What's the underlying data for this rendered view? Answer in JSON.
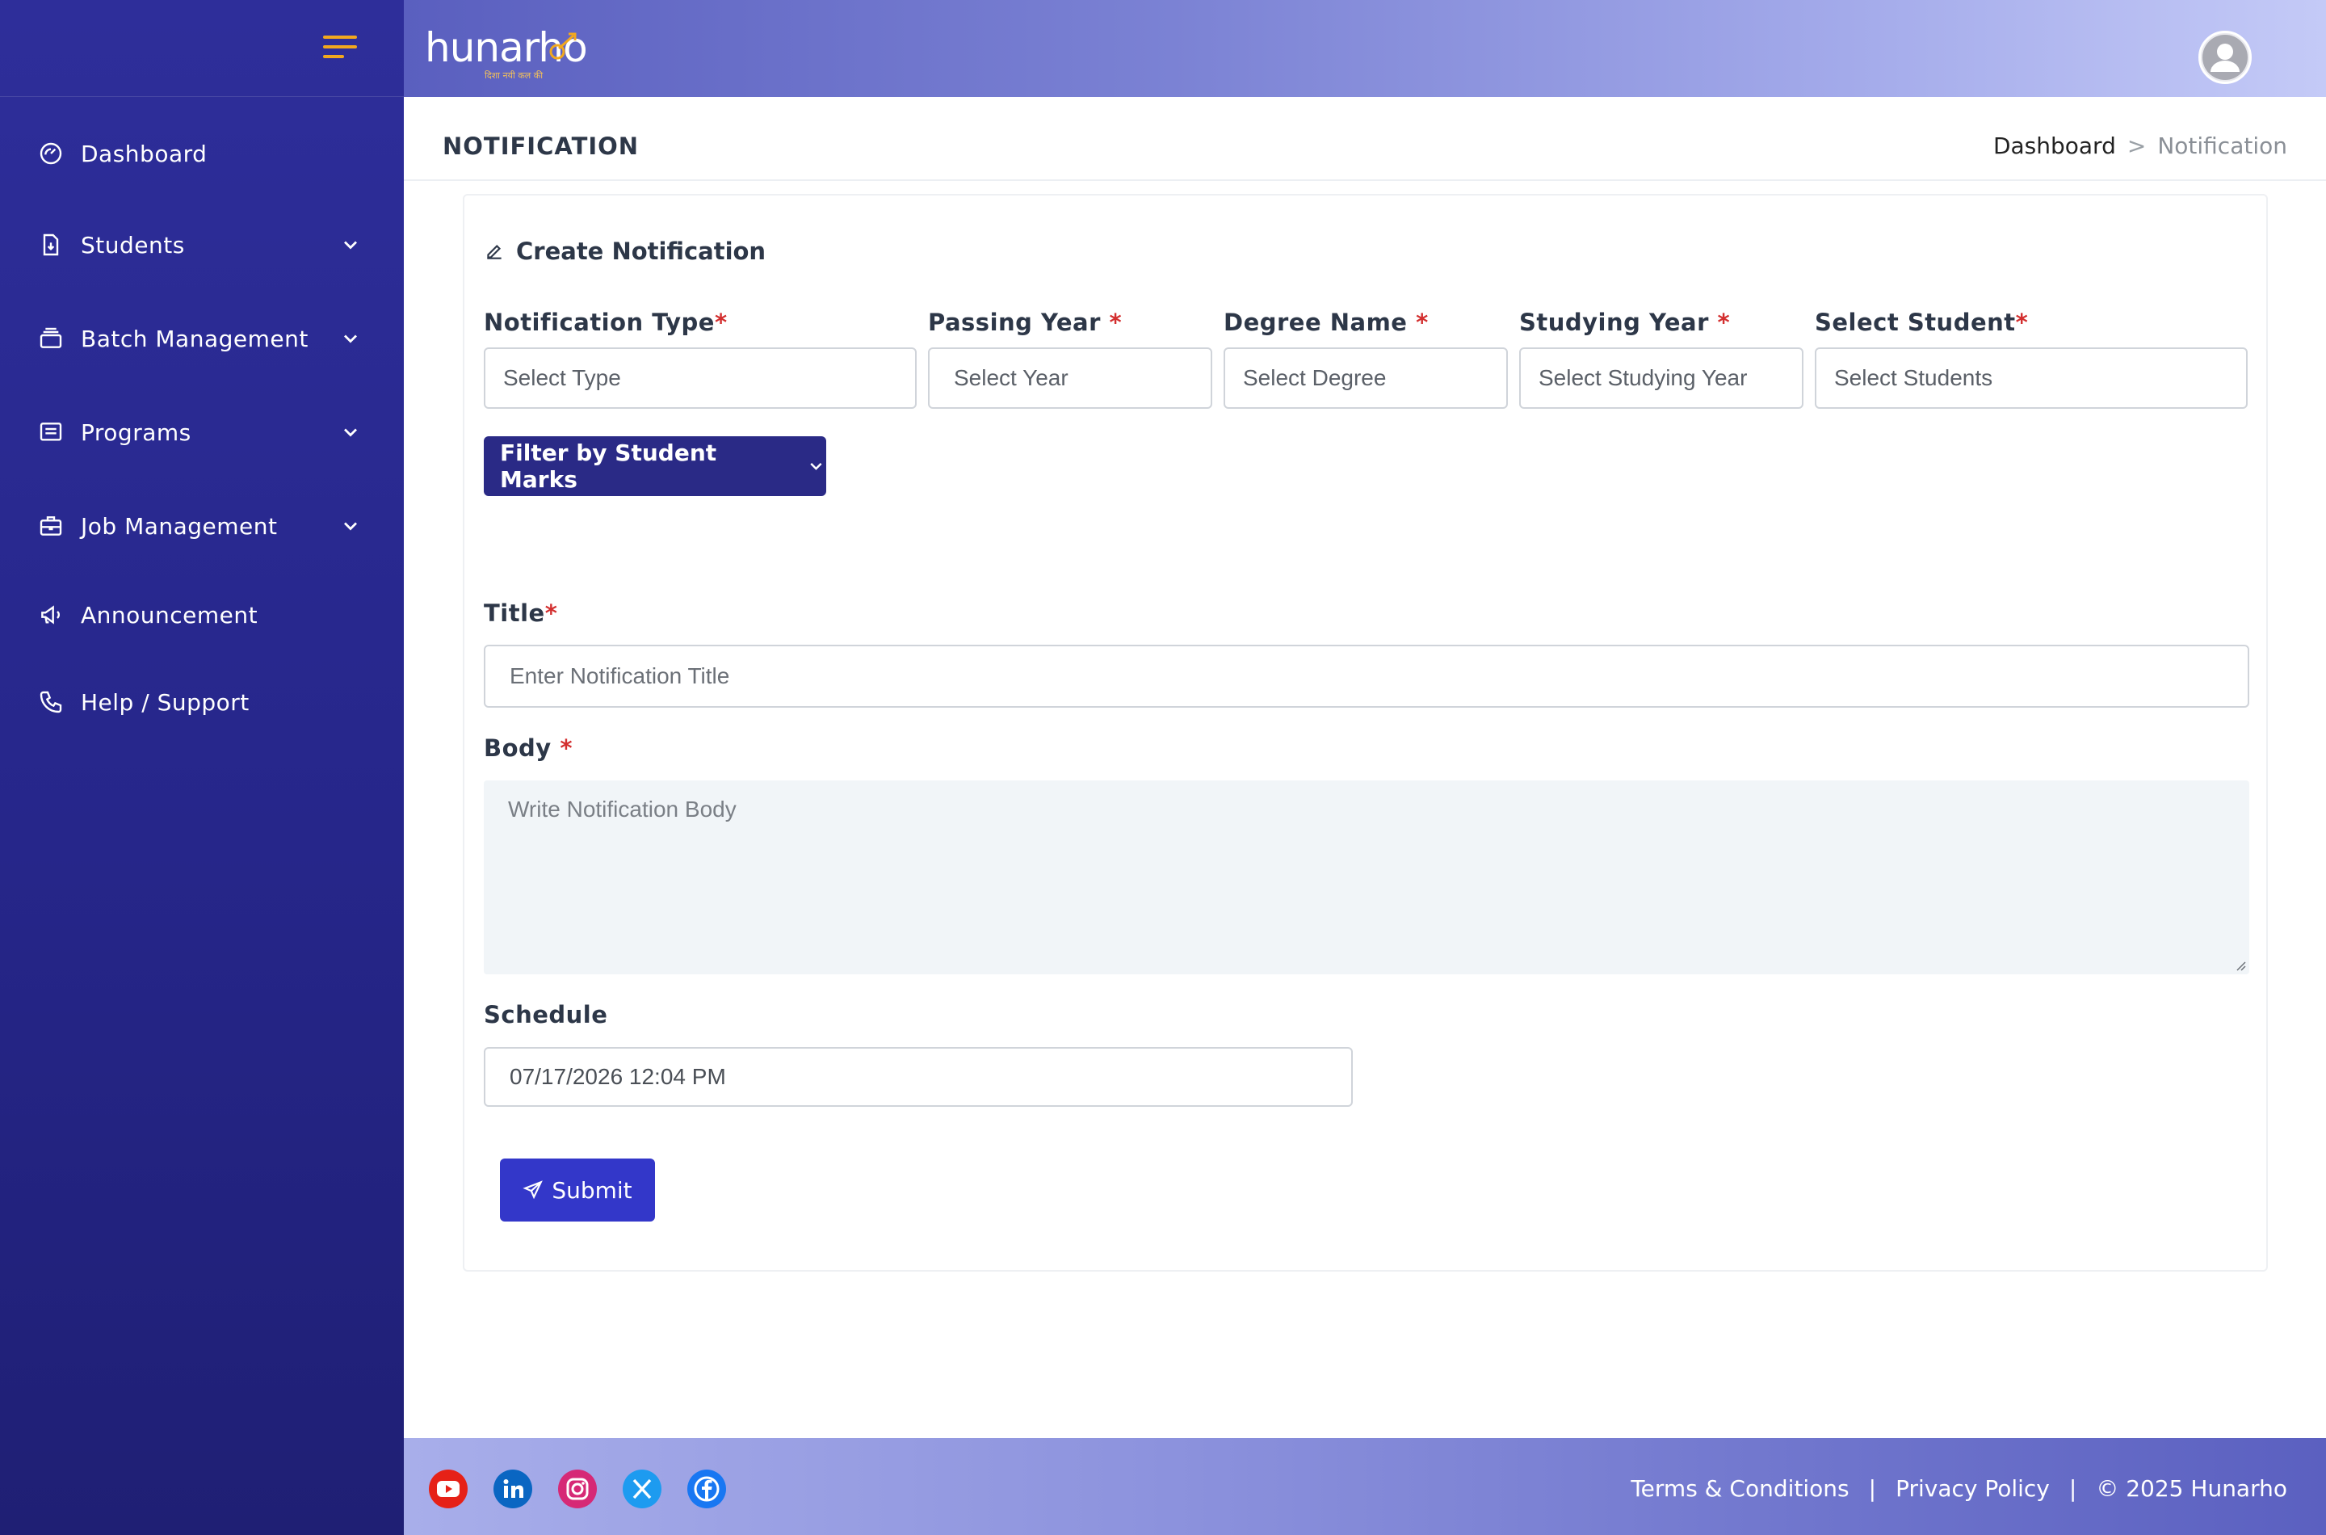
{
  "app": {
    "logo_text": "hunarho",
    "logo_tagline": "दिशा नयी कल की"
  },
  "sidebar": {
    "items": [
      {
        "label": "Dashboard",
        "icon": "gauge-icon",
        "expandable": false
      },
      {
        "label": "Students",
        "icon": "file-download-icon",
        "expandable": true
      },
      {
        "label": "Batch Management",
        "icon": "layers-icon",
        "expandable": true
      },
      {
        "label": "Programs",
        "icon": "list-box-icon",
        "expandable": true
      },
      {
        "label": "Job Management",
        "icon": "briefcase-icon",
        "expandable": true
      },
      {
        "label": "Announcement",
        "icon": "megaphone-icon",
        "expandable": false
      },
      {
        "label": "Help / Support",
        "icon": "phone-icon",
        "expandable": false
      }
    ]
  },
  "page": {
    "title": "NOTIFICATION",
    "breadcrumb": {
      "home": "Dashboard",
      "separator": ">",
      "current": "Notification"
    }
  },
  "form": {
    "card_title": "Create Notification",
    "fields": {
      "notification_type": {
        "label": "Notification Type",
        "required_mark": "*",
        "placeholder": "Select Type"
      },
      "passing_year": {
        "label": "Passing Year",
        "required_mark": "*",
        "placeholder": "Select Year"
      },
      "degree_name": {
        "label": "Degree Name",
        "required_mark": "*",
        "placeholder": "Select Degree"
      },
      "studying_year": {
        "label": "Studying Year",
        "required_mark": "*",
        "placeholder": "Select Studying Year"
      },
      "select_student": {
        "label": "Select Student",
        "required_mark": "*",
        "placeholder": "Select Students"
      }
    },
    "filter_button": "Filter by Student Marks",
    "title_field": {
      "label": "Title",
      "required_mark": "*",
      "placeholder": "Enter Notification Title"
    },
    "body_field": {
      "label": "Body",
      "required_mark": "*",
      "placeholder": "Write Notification Body"
    },
    "schedule_field": {
      "label": "Schedule",
      "value": "07/17/2026 12:04 PM"
    },
    "submit_label": "Submit"
  },
  "footer": {
    "social": [
      "youtube-icon",
      "linkedin-icon",
      "instagram-icon",
      "x-icon",
      "facebook-icon"
    ],
    "links": {
      "terms": "Terms & Conditions",
      "privacy": "Privacy Policy",
      "copyright": "© 2025 Hunarho"
    },
    "separator": "|"
  },
  "colors": {
    "sidebar_bg": "#2e2e9a",
    "accent": "#3337c9",
    "filter_button": "#2a2a86",
    "required": "#d32f2f",
    "hamburger": "#f2a81e"
  }
}
